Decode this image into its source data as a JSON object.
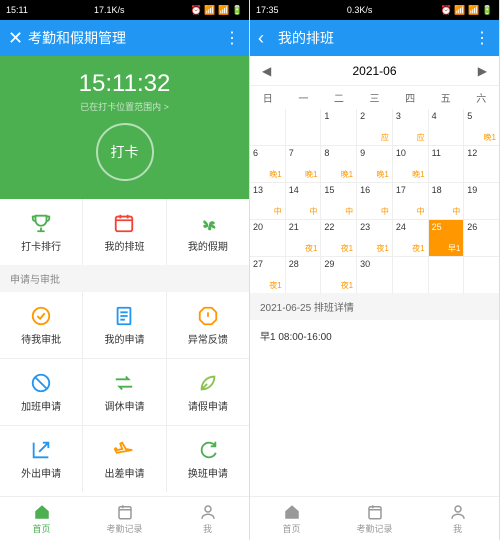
{
  "left": {
    "status": {
      "time": "15:11",
      "speed": "17.1K/s",
      "icons": "⏰ 📶 📶 🔋"
    },
    "title": "考勤和假期管理",
    "hero": {
      "time": "15:11:32",
      "loc": "已在打卡位置范围内 >",
      "punch": "打卡"
    },
    "grid1": [
      {
        "label": "打卡排行",
        "color": "#4caf50"
      },
      {
        "label": "我的排班",
        "color": "#f44336"
      },
      {
        "label": "我的假期",
        "color": "#4caf50"
      }
    ],
    "sectionTitle": "申请与审批",
    "grid2": [
      {
        "label": "待我审批",
        "color": "#ff9800"
      },
      {
        "label": "我的申请",
        "color": "#2196f3"
      },
      {
        "label": "异常反馈",
        "color": "#ff9800"
      },
      {
        "label": "加班申请",
        "color": "#2196f3"
      },
      {
        "label": "调休申请",
        "color": "#4caf50"
      },
      {
        "label": "请假申请",
        "color": "#8bc34a"
      },
      {
        "label": "外出申请",
        "color": "#2196f3"
      },
      {
        "label": "出差申请",
        "color": "#ff9800"
      },
      {
        "label": "换班申请",
        "color": "#4caf50"
      }
    ],
    "nav": [
      {
        "label": "首页"
      },
      {
        "label": "考勤记录"
      },
      {
        "label": "我"
      }
    ]
  },
  "right": {
    "status": {
      "time": "17:35",
      "speed": "0.3K/s",
      "icons": "⏰ 📶 📶 🔋"
    },
    "title": "我的排班",
    "month": "2021-06",
    "weekdays": [
      "日",
      "一",
      "二",
      "三",
      "四",
      "五",
      "六"
    ],
    "days": [
      {
        "n": "",
        "t": ""
      },
      {
        "n": "",
        "t": ""
      },
      {
        "n": "1",
        "t": ""
      },
      {
        "n": "2",
        "t": "应"
      },
      {
        "n": "3",
        "t": "应"
      },
      {
        "n": "4",
        "t": ""
      },
      {
        "n": "5",
        "t": "晚1"
      },
      {
        "n": "6",
        "t": "晚1"
      },
      {
        "n": "7",
        "t": "晚1"
      },
      {
        "n": "8",
        "t": "晚1"
      },
      {
        "n": "9",
        "t": "晚1"
      },
      {
        "n": "10",
        "t": "晚1"
      },
      {
        "n": "11",
        "t": ""
      },
      {
        "n": "12",
        "t": ""
      },
      {
        "n": "13",
        "t": "中"
      },
      {
        "n": "14",
        "t": "中"
      },
      {
        "n": "15",
        "t": "中"
      },
      {
        "n": "16",
        "t": "中"
      },
      {
        "n": "17",
        "t": "中"
      },
      {
        "n": "18",
        "t": "中"
      },
      {
        "n": "19",
        "t": ""
      },
      {
        "n": "20",
        "t": ""
      },
      {
        "n": "21",
        "t": "夜1"
      },
      {
        "n": "22",
        "t": "夜1"
      },
      {
        "n": "23",
        "t": "夜1"
      },
      {
        "n": "24",
        "t": "夜1"
      },
      {
        "n": "25",
        "t": "早1",
        "sel": true
      },
      {
        "n": "26",
        "t": ""
      },
      {
        "n": "27",
        "t": "夜1"
      },
      {
        "n": "28",
        "t": ""
      },
      {
        "n": "29",
        "t": "夜1"
      },
      {
        "n": "30",
        "t": ""
      },
      {
        "n": "",
        "t": ""
      },
      {
        "n": "",
        "t": ""
      },
      {
        "n": "",
        "t": ""
      }
    ],
    "detailHeader": "2021-06-25  排班详情",
    "detailBody": "早1  08:00-16:00",
    "nav": [
      {
        "label": "首页"
      },
      {
        "label": "考勤记录"
      },
      {
        "label": "我"
      }
    ]
  }
}
